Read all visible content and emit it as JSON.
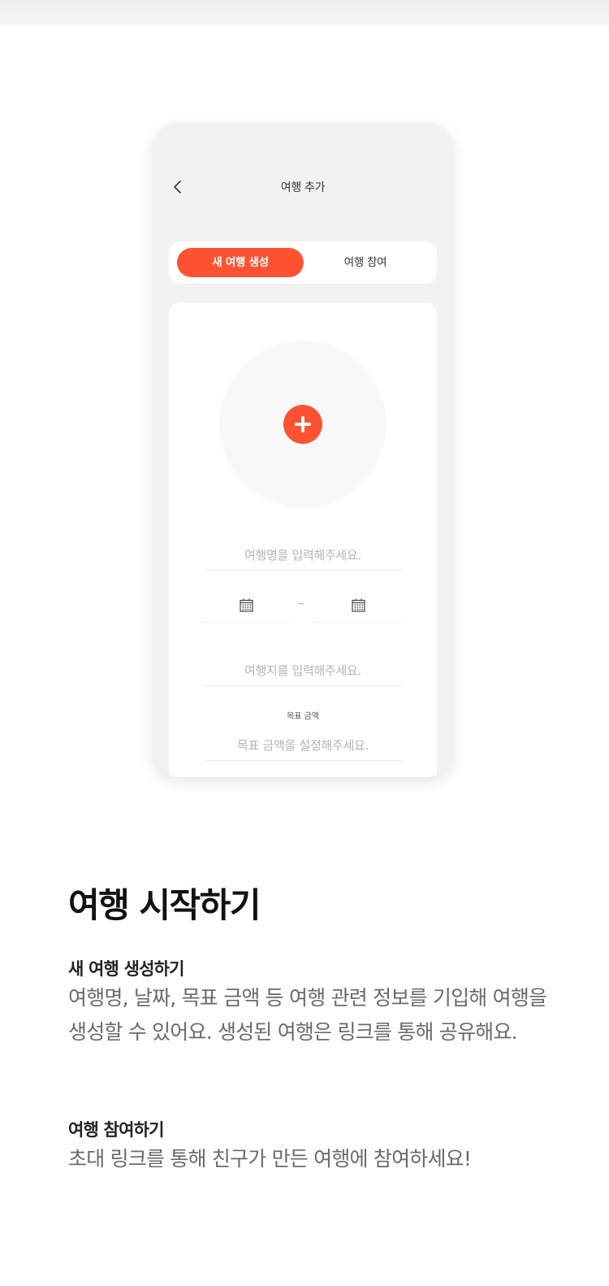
{
  "phone": {
    "nav_title": "여행 추가",
    "tabs": [
      {
        "label": "새 여행 생성",
        "active": true
      },
      {
        "label": "여행 참여",
        "active": false
      }
    ],
    "form": {
      "trip_name_placeholder": "여행명을 입력해주세요.",
      "date_separator": "~",
      "destination_placeholder": "여행지를 입력해주세요.",
      "goal_label": "목표 금액",
      "goal_placeholder": "목표 금액을 설정해주세요."
    },
    "icons": {
      "back": "chevron-left-icon",
      "add": "plus-icon",
      "date": "calendar-icon"
    }
  },
  "section": {
    "title": "여행 시작하기",
    "items": [
      {
        "heading": "새 여행 생성하기",
        "description": "여행명, 날짜, 목표 금액 등 여행 관련 정보를 기입해 여행을 생성할 수 있어요. 생성된 여행은 링크를 통해 공유해요."
      },
      {
        "heading": "여행 참여하기",
        "description": "초대 링크를 통해 친구가 만든 여행에 참여하세요!"
      }
    ]
  },
  "colors": {
    "accent": "#ff5232",
    "background": "#f2f2f2"
  }
}
